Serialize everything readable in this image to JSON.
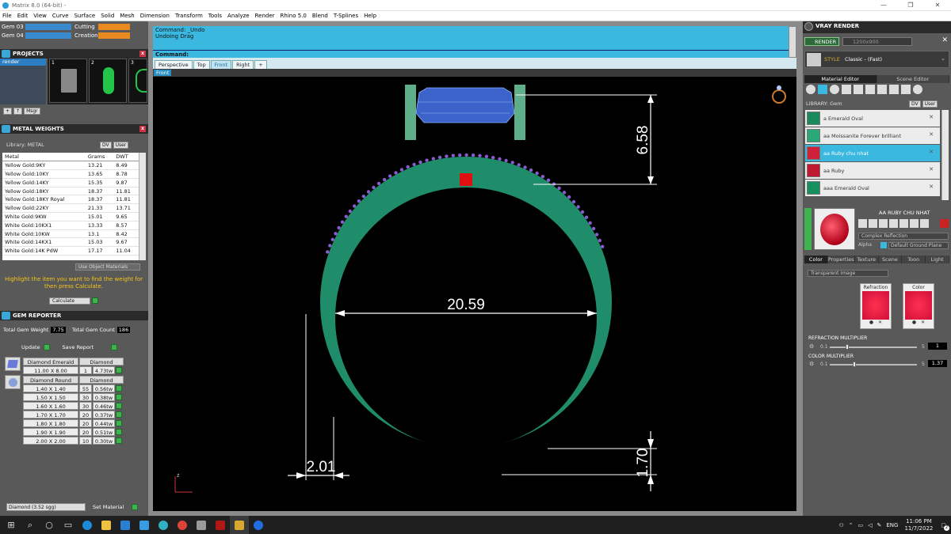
{
  "window": {
    "title": "Matrix 8.0 (64-bit) -",
    "minimize": "—",
    "maximize": "❐",
    "close": "✕"
  },
  "menu": [
    "File",
    "Edit",
    "View",
    "Curve",
    "Surface",
    "Solid",
    "Mesh",
    "Dimension",
    "Transform",
    "Tools",
    "Analyze",
    "Render",
    "Rhino 5.0",
    "Blend",
    "T-Splines",
    "Help"
  ],
  "layers": {
    "row1": "Gem 03",
    "row2": "Gem 04",
    "right1": "Cutting",
    "right2": "Creation"
  },
  "projects": {
    "title": "PROJECTS",
    "selected_item": "render",
    "thumb_numbers": [
      "1",
      "2",
      "3"
    ],
    "msgr": "Msgr"
  },
  "metal_weights": {
    "title": "METAL WEIGHTS",
    "library_label": "Library: METAL",
    "dv": "DV",
    "user": "User",
    "columns": [
      "Metal",
      "Grams",
      "DWT"
    ],
    "rows": [
      [
        "Yellow Gold:9KY",
        "13.21",
        "8.49"
      ],
      [
        "Yellow Gold:10KY",
        "13.65",
        "8.78"
      ],
      [
        "Yellow Gold:14KY",
        "15.35",
        "9.87"
      ],
      [
        "Yellow Gold:18KY",
        "18.37",
        "11.81"
      ],
      [
        "Yellow Gold:18KY Royal",
        "18.37",
        "11.81"
      ],
      [
        "Yellow Gold:22KY",
        "21.33",
        "13.71"
      ],
      [
        "White Gold:9KW",
        "15.01",
        "9.65"
      ],
      [
        "White Gold:10KX1",
        "13.33",
        "8.57"
      ],
      [
        "White Gold:10KW",
        "13.1",
        "8.42"
      ],
      [
        "White Gold:14KX1",
        "15.03",
        "9.67"
      ],
      [
        "White Gold:14K PdW",
        "17.17",
        "11.04"
      ]
    ],
    "use_object_materials": "Use Object Materials",
    "hint": "Highlight the item you want to find the weight for then press Calculate.",
    "calculate": "Calculate"
  },
  "gem_reporter": {
    "title": "GEM REPORTER",
    "total_weight_label": "Total Gem Weight",
    "total_weight": "7.75",
    "total_count_label": "Total Gem Count",
    "total_count": "186",
    "update": "Update",
    "save_report": "Save Report",
    "group1": {
      "name": "Diamond Emerald",
      "material": "Diamond",
      "rows": [
        [
          "11.00 X 8.00",
          "1",
          "4.73tw"
        ]
      ]
    },
    "group2": {
      "name": "Diamond Round",
      "material": "Diamond",
      "rows": [
        [
          "1.40 X 1.40",
          "55",
          "0.56tw"
        ],
        [
          "1.50 X 1.50",
          "30",
          "0.38tw"
        ],
        [
          "1.60 X 1.60",
          "30",
          "0.46tw"
        ],
        [
          "1.70 X 1.70",
          "20",
          "0.37tw"
        ],
        [
          "1.80 X 1.80",
          "20",
          "0.44tw"
        ],
        [
          "1.90 X 1.90",
          "20",
          "0.51tw"
        ],
        [
          "2.00 X 2.00",
          "10",
          "0.30tw"
        ]
      ]
    }
  },
  "bottom_left": {
    "material_select": "Diamond    (3.52 sgg)",
    "set_material": "Set Material"
  },
  "command": {
    "line1": "Command: _Undo",
    "line2": "Undoing Drag",
    "prompt": "Command:"
  },
  "viewport": {
    "tabs": [
      "Perspective",
      "Top",
      "Front",
      "Right",
      "+"
    ],
    "active_tab": "Front",
    "label": "Front",
    "dims": {
      "top": "6.58",
      "width": "20.59",
      "thickness": "2.01",
      "bottom": "1.70"
    },
    "axis_z": "z",
    "colors": {
      "band": "#1f8c6a",
      "gem": "#3b63c9",
      "prongs": "#5fae8a",
      "beads": "#8a5ad0",
      "marker": "#e01010"
    }
  },
  "vray": {
    "title": "VRAY RENDER",
    "render": "RENDER",
    "resolution": "1200x900",
    "style_label": "STYLE",
    "style_value": "Classic - (Fast)",
    "tabs": [
      "Material Editor",
      "Scene Editor"
    ],
    "library_label": "LIBRARY: Gem",
    "dv": "DV",
    "user": "User",
    "materials": [
      {
        "name": "a Emerald Oval",
        "color": "#1a8a5a"
      },
      {
        "name": "aa Moissanite Forever brilliant",
        "color": "#2aa878"
      },
      {
        "name": "aa Ruby chu nhat",
        "color": "#d0203a"
      },
      {
        "name": "aa Ruby",
        "color": "#c01830"
      },
      {
        "name": "aaa Emerald Oval",
        "color": "#179060"
      }
    ],
    "selected_material": "AA RUBY CHU NHAT",
    "complex_reflection": "Complex Reflection",
    "alpha": "Alpha",
    "ground_plane": "Default Ground Plane",
    "subtabs": [
      "Color",
      "Properties",
      "Texture",
      "Scene",
      "Toon",
      "Light"
    ],
    "transparent": "Transparent Image",
    "refraction": "Refraction",
    "color": "Color",
    "refraction_mult_label": "REFRACTION MULTIPLIER",
    "refraction_mult_min": "0.1",
    "refraction_mult_max": "5",
    "refraction_mult_value": "1",
    "color_mult_label": "COLOR MULTIPLIER",
    "color_mult_min": "0.1",
    "color_mult_max": "5",
    "color_mult_value": "1.37"
  },
  "taskbar": {
    "lang": "ENG",
    "time": "11:06 PM",
    "date": "11/7/2022",
    "notify": "2"
  }
}
